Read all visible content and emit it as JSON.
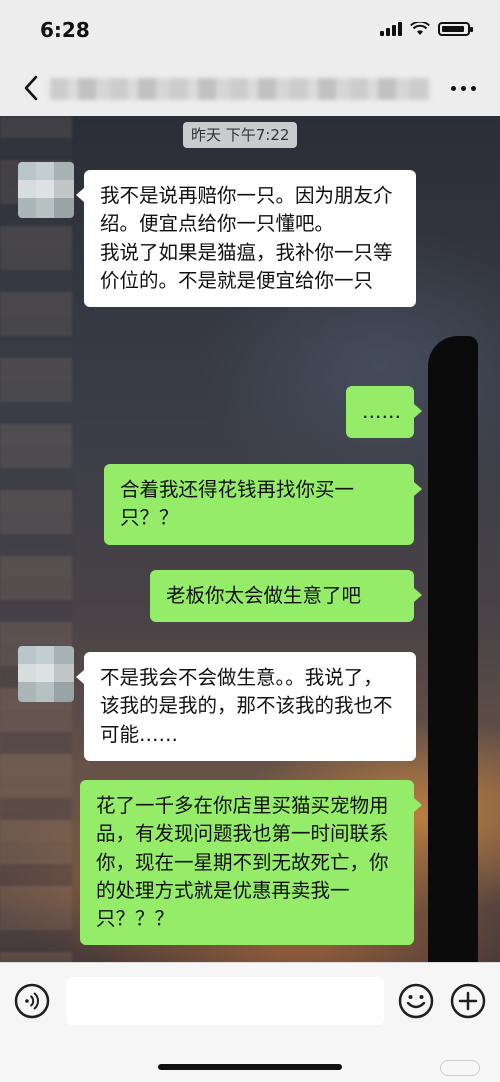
{
  "status_bar": {
    "time": "6:28"
  },
  "nav": {
    "back_icon": "chevron-left-icon",
    "more_icon": "more-dots-icon"
  },
  "chat": {
    "timestamp": "昨天 下午7:22",
    "messages": [
      {
        "side": "left",
        "text": "我不是说再赔你一只。因为朋友介绍。便宜点给你一只懂吧。\n我说了如果是猫瘟，我补你一只等价位的。不是就是便宜给你一只"
      },
      {
        "side": "right",
        "text": "……"
      },
      {
        "side": "right",
        "text": "合着我还得花钱再找你买一只？？"
      },
      {
        "side": "right",
        "text": "老板你太会做生意了吧"
      },
      {
        "side": "left",
        "text": "不是我会不会做生意。。我说了，该我的是我的，那不该我的我也不可能……"
      },
      {
        "side": "right",
        "text": "花了一千多在你店里买猫买宠物用品，有发现问题我也第一时间联系你，现在一星期不到无故死亡，你的处理方式就是优惠再卖我一只？？？"
      }
    ]
  },
  "input_bar": {
    "voice_icon": "voice-icon",
    "emoji_icon": "emoji-icon",
    "plus_icon": "plus-icon",
    "placeholder": ""
  },
  "colors": {
    "sent_bubble": "#95ec69",
    "received_bubble": "#ffffff",
    "bar_background": "#ededed"
  }
}
